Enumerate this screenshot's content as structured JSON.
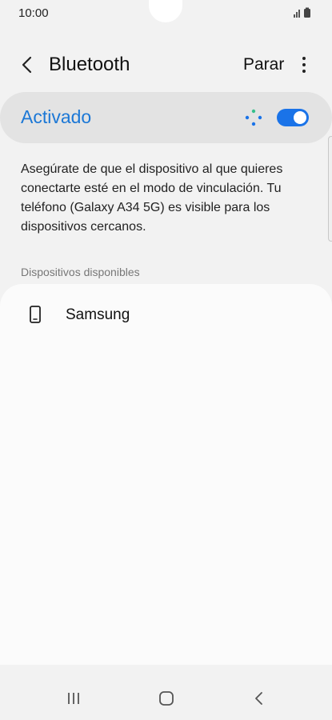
{
  "status_bar": {
    "time": "10:00",
    "icons": [
      "signal-icon",
      "battery-icon"
    ]
  },
  "header": {
    "back_icon": "chevron-left-icon",
    "title": "Bluetooth",
    "action_label": "Parar",
    "more_icon": "more-vertical-icon"
  },
  "toggle": {
    "label": "Activado",
    "state": "on",
    "scanning_icon": "scanning-dots-icon",
    "accent_color": "#1a73e8"
  },
  "description": "Asegúrate de que el dispositivo al que quieres conectarte esté en el modo de vinculación. Tu teléfono (Galaxy A34 5G) es visible para los dispositivos cercanos.",
  "available_devices": {
    "section_title": "Dispositivos disponibles",
    "devices": [
      {
        "name": "Samsung",
        "icon": "phone-icon"
      }
    ]
  },
  "nav_bar": {
    "buttons": [
      "recent-apps-icon",
      "home-icon",
      "back-icon"
    ]
  }
}
